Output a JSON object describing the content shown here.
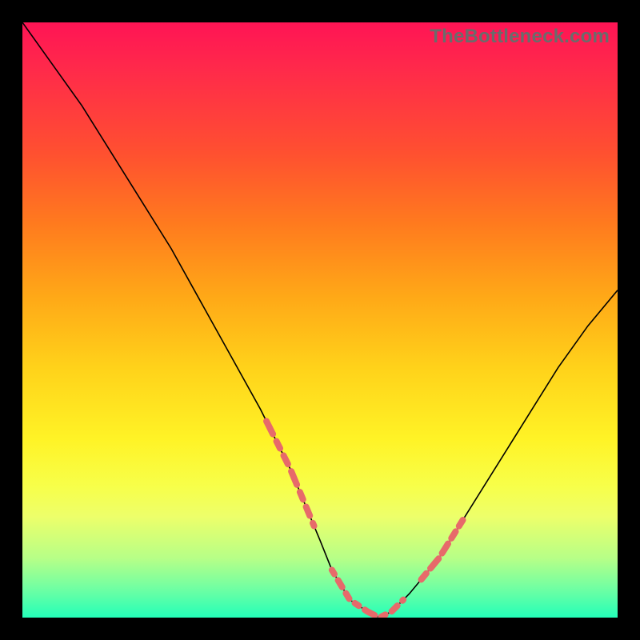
{
  "watermark": "TheBottleneck.com",
  "chart_data": {
    "type": "line",
    "title": "",
    "xlabel": "",
    "ylabel": "",
    "xlim": [
      0,
      100
    ],
    "ylim": [
      0,
      100
    ],
    "grid": false,
    "legend": false,
    "series": [
      {
        "name": "bottleneck-curve",
        "x": [
          0,
          5,
          10,
          15,
          20,
          25,
          30,
          35,
          40,
          45,
          50,
          52,
          55,
          58,
          60,
          62,
          65,
          70,
          75,
          80,
          85,
          90,
          95,
          100
        ],
        "y": [
          100,
          93,
          86,
          78,
          70,
          62,
          53,
          44,
          35,
          25,
          13,
          8,
          3,
          1,
          0,
          1,
          4,
          10,
          18,
          26,
          34,
          42,
          49,
          55
        ]
      }
    ],
    "annotations": [
      {
        "name": "left-highlight-band",
        "type": "dashed-segment",
        "x_range": [
          41,
          49
        ],
        "color": "#e76a6a"
      },
      {
        "name": "trough-highlight-band",
        "type": "dashed-segment",
        "x_range": [
          52,
          64
        ],
        "color": "#e76a6a"
      },
      {
        "name": "right-highlight-band",
        "type": "dashed-segment",
        "x_range": [
          67,
          74
        ],
        "color": "#e76a6a"
      }
    ],
    "background_gradient": {
      "top": "#ff1455",
      "middle": "#ffd21a",
      "bottom": "#24ffb8"
    }
  }
}
